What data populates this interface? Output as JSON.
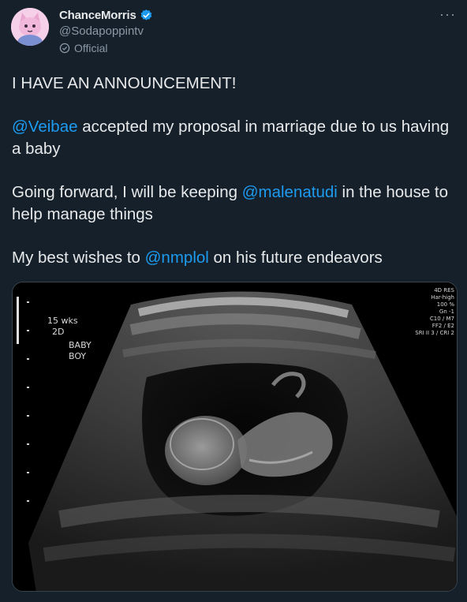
{
  "tweet": {
    "author": {
      "display_name": "ChanceMorris",
      "handle": "@Sodapoppintv",
      "label": "Official",
      "verified": true,
      "avatar_icon": "pink-cat-avatar"
    },
    "text": {
      "line1": "I HAVE AN ANNOUNCEMENT!",
      "p2_mention": "@Veibae",
      "p2_rest": " accepted my proposal in marriage due to us having a baby",
      "p3_pre": "Going forward, I will be keeping ",
      "p3_mention": "@malenatudi",
      "p3_post": " in the house to help manage things",
      "p4_pre": "My best wishes to ",
      "p4_mention": "@nmplol",
      "p4_post": " on his future endeavors"
    },
    "media": {
      "overlay_left": [
        "15 wks",
        "2D",
        "BABY",
        "BOY"
      ],
      "overlay_right": [
        "4D RES",
        "Har-high",
        "100 %",
        "Gn -1",
        "C10 / M7",
        "FF2 / E2",
        "SRI II 3 / CRI 2"
      ]
    }
  },
  "colors": {
    "background": "#15202b",
    "text": "#e7e9ea",
    "secondary": "#8b98a5",
    "accent": "#1d9bf0"
  }
}
